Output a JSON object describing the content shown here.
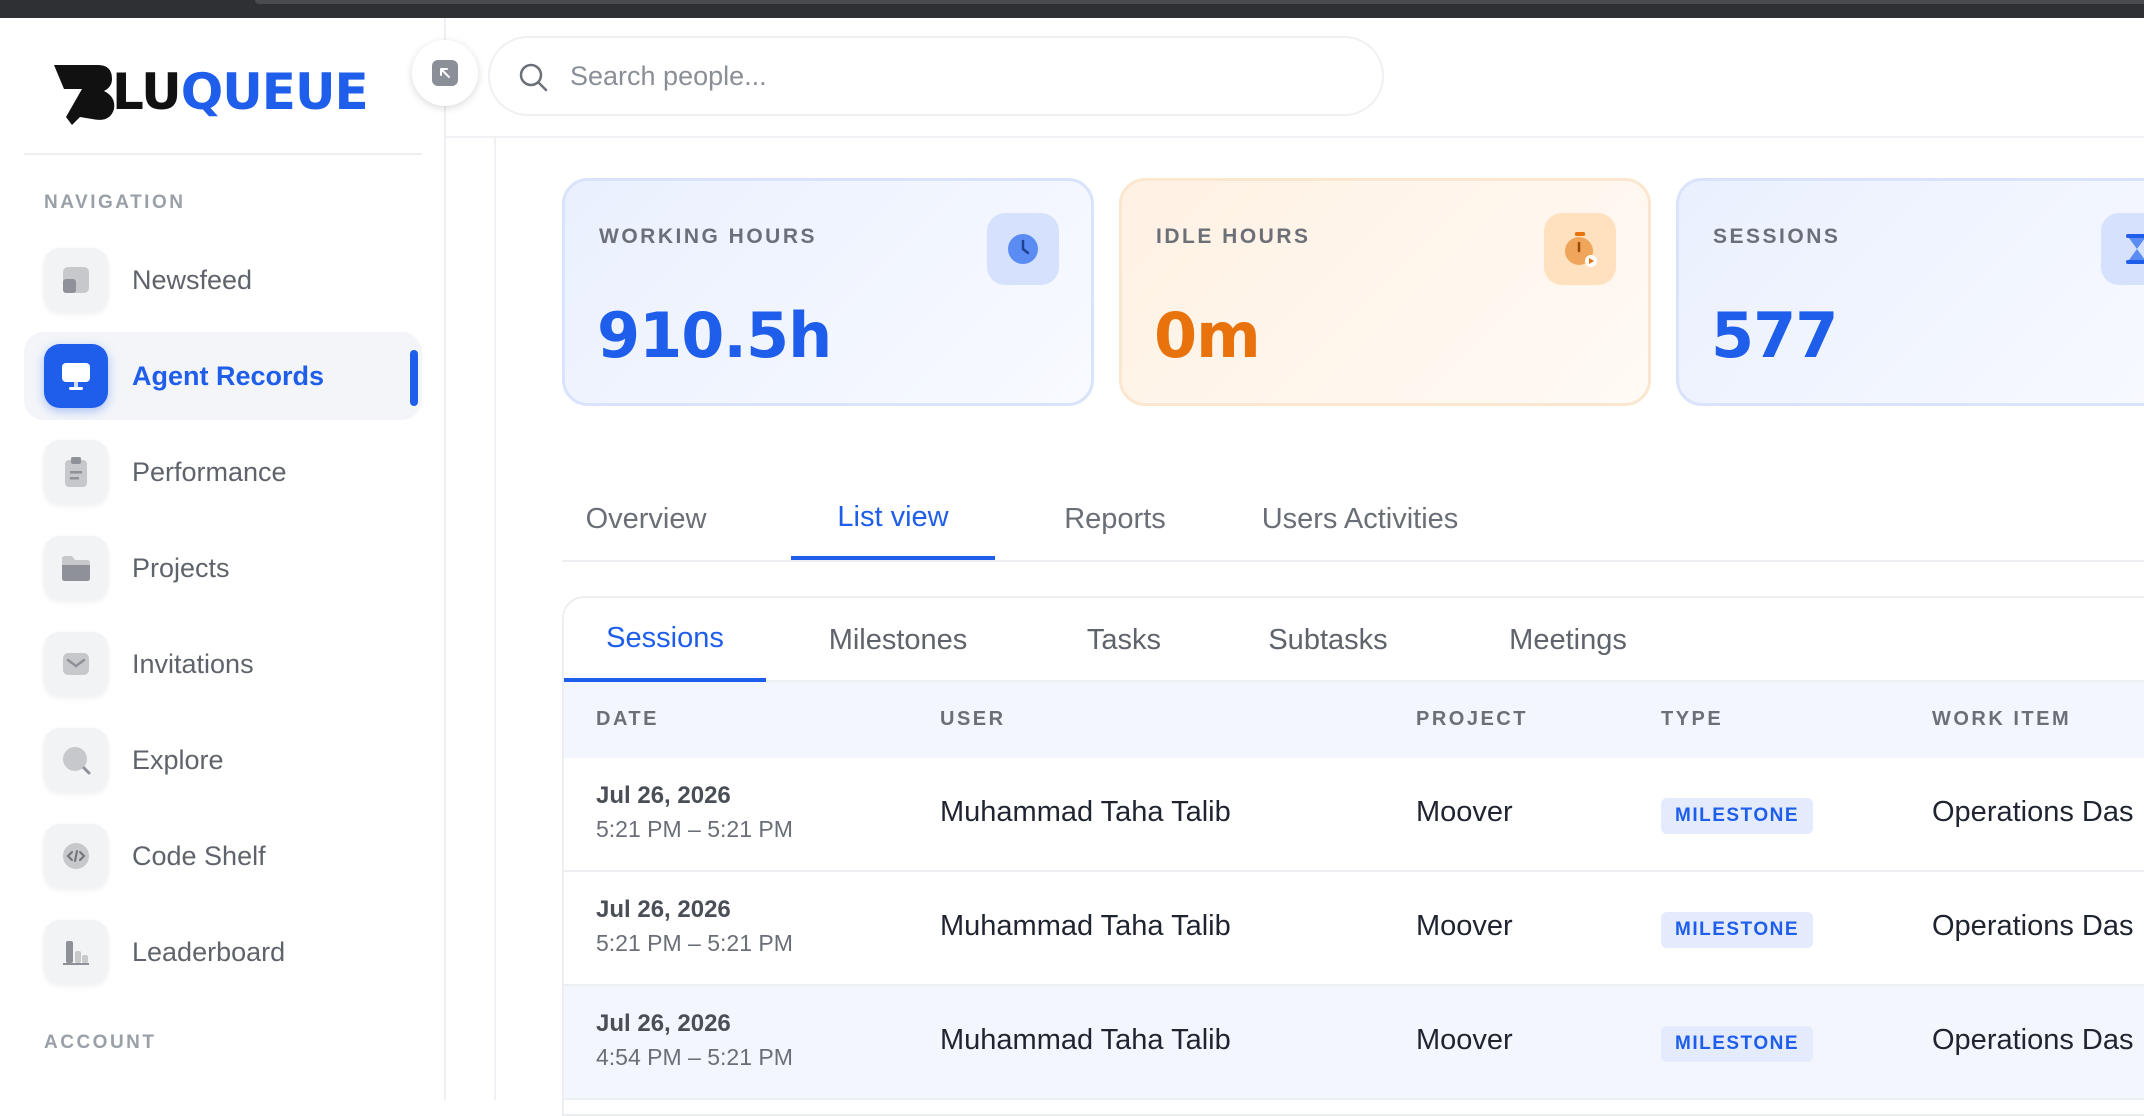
{
  "brand": {
    "logo_part1": "LU",
    "logo_part2": "QUEUE",
    "logo_color": "#1f5eea"
  },
  "search": {
    "placeholder": "Search people..."
  },
  "sidebar": {
    "navigation_label": "NAVIGATION",
    "account_label": "ACCOUNT",
    "items": [
      {
        "label": "Newsfeed",
        "icon": "newsfeed-icon"
      },
      {
        "label": "Agent Records",
        "icon": "monitor-icon",
        "active": true
      },
      {
        "label": "Performance",
        "icon": "clipboard-icon"
      },
      {
        "label": "Projects",
        "icon": "folder-icon"
      },
      {
        "label": "Invitations",
        "icon": "mail-icon"
      },
      {
        "label": "Explore",
        "icon": "explore-icon"
      },
      {
        "label": "Code Shelf",
        "icon": "code-icon"
      },
      {
        "label": "Leaderboard",
        "icon": "leaderboard-icon"
      }
    ]
  },
  "stats": [
    {
      "label": "WORKING HOURS",
      "value": "910.5h",
      "icon": "clock-icon",
      "color": "#1f5eea"
    },
    {
      "label": "IDLE HOURS",
      "value": "0m",
      "icon": "stopwatch-icon",
      "color": "#e8720c"
    },
    {
      "label": "SESSIONS",
      "value": "577",
      "icon": "hourglass-icon",
      "color": "#1f5eea"
    }
  ],
  "tabs": [
    "Overview",
    "List view",
    "Reports",
    "Users Activities"
  ],
  "active_tab": "List view",
  "subtabs": [
    "Sessions",
    "Milestones",
    "Tasks",
    "Subtasks",
    "Meetings"
  ],
  "active_subtab": "Sessions",
  "table": {
    "columns": [
      "DATE",
      "USER",
      "PROJECT",
      "TYPE",
      "WORK ITEM"
    ],
    "rows": [
      {
        "date": "Jul 26, 2026",
        "time": "5:21 PM – 5:21 PM",
        "user": "Muhammad Taha Talib",
        "project": "Moover",
        "type": "MILESTONE",
        "work_item": "Operations Das"
      },
      {
        "date": "Jul 26, 2026",
        "time": "5:21 PM – 5:21 PM",
        "user": "Muhammad Taha Talib",
        "project": "Moover",
        "type": "MILESTONE",
        "work_item": "Operations Das"
      },
      {
        "date": "Jul 26, 2026",
        "time": "4:54 PM – 5:21 PM",
        "user": "Muhammad Taha Talib",
        "project": "Moover",
        "type": "MILESTONE",
        "work_item": "Operations Das"
      }
    ]
  }
}
